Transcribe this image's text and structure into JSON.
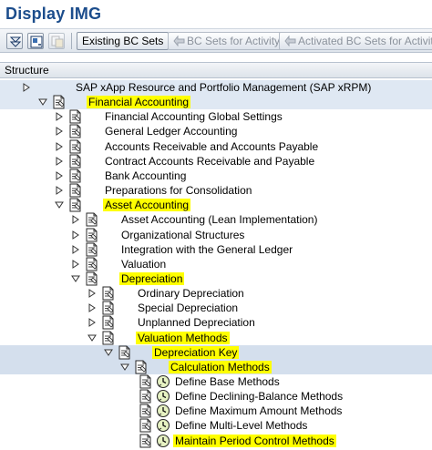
{
  "window": {
    "title": "Display IMG"
  },
  "toolbar": {
    "buttons": [
      {
        "label": "Existing BC Sets",
        "enabled": true
      },
      {
        "label": "BC Sets for Activity",
        "enabled": false
      },
      {
        "label": "Activated BC Sets for Activity",
        "enabled": false
      }
    ]
  },
  "tree": {
    "header": "Structure",
    "nodes": [
      {
        "label": "SAP xApp Resource and Portfolio Management (SAP xRPM)",
        "state": "collapsed",
        "icon": "none",
        "highlight": false
      },
      {
        "label": "Financial Accounting",
        "state": "expanded",
        "icon": "doc",
        "highlight": true
      },
      {
        "label": "Financial Accounting Global Settings",
        "state": "collapsed",
        "icon": "doc",
        "highlight": false
      },
      {
        "label": "General Ledger Accounting",
        "state": "collapsed",
        "icon": "doc",
        "highlight": false
      },
      {
        "label": "Accounts Receivable and Accounts Payable",
        "state": "collapsed",
        "icon": "doc",
        "highlight": false
      },
      {
        "label": "Contract Accounts Receivable and Payable",
        "state": "collapsed",
        "icon": "doc",
        "highlight": false
      },
      {
        "label": "Bank Accounting",
        "state": "collapsed",
        "icon": "doc",
        "highlight": false
      },
      {
        "label": "Preparations for Consolidation",
        "state": "collapsed",
        "icon": "doc",
        "highlight": false
      },
      {
        "label": "Asset Accounting",
        "state": "expanded",
        "icon": "doc",
        "highlight": true
      },
      {
        "label": "Asset Accounting (Lean Implementation)",
        "state": "collapsed",
        "icon": "doc",
        "highlight": false
      },
      {
        "label": "Organizational Structures",
        "state": "collapsed",
        "icon": "doc",
        "highlight": false
      },
      {
        "label": "Integration with the General Ledger",
        "state": "collapsed",
        "icon": "doc",
        "highlight": false
      },
      {
        "label": "Valuation",
        "state": "collapsed",
        "icon": "doc",
        "highlight": false
      },
      {
        "label": "Depreciation",
        "state": "expanded",
        "icon": "doc",
        "highlight": true
      },
      {
        "label": "Ordinary Depreciation",
        "state": "collapsed",
        "icon": "doc",
        "highlight": false
      },
      {
        "label": "Special Depreciation",
        "state": "collapsed",
        "icon": "doc",
        "highlight": false
      },
      {
        "label": "Unplanned Depreciation",
        "state": "collapsed",
        "icon": "doc",
        "highlight": false
      },
      {
        "label": "Valuation Methods",
        "state": "expanded",
        "icon": "doc",
        "highlight": true
      },
      {
        "label": "Depreciation Key",
        "state": "expanded",
        "icon": "doc",
        "highlight": true
      },
      {
        "label": "Calculation Methods",
        "state": "expanded",
        "icon": "doc",
        "highlight": true
      },
      {
        "label": "Define Base Methods",
        "state": "leaf",
        "icon": "doc-clock",
        "highlight": false
      },
      {
        "label": "Define Declining-Balance Methods",
        "state": "leaf",
        "icon": "doc-clock",
        "highlight": false
      },
      {
        "label": "Define Maximum Amount Methods",
        "state": "leaf",
        "icon": "doc-clock",
        "highlight": false
      },
      {
        "label": "Define Multi-Level Methods",
        "state": "leaf",
        "icon": "doc-clock",
        "highlight": false
      },
      {
        "label": "Maintain Period Control Methods",
        "state": "leaf",
        "icon": "doc-clock",
        "highlight": true
      }
    ]
  },
  "colors": {
    "title": "#1c4d8c",
    "highlight": "#ffff00",
    "selected_band": "#d4dfed",
    "row_band": "#dfe8f3"
  }
}
